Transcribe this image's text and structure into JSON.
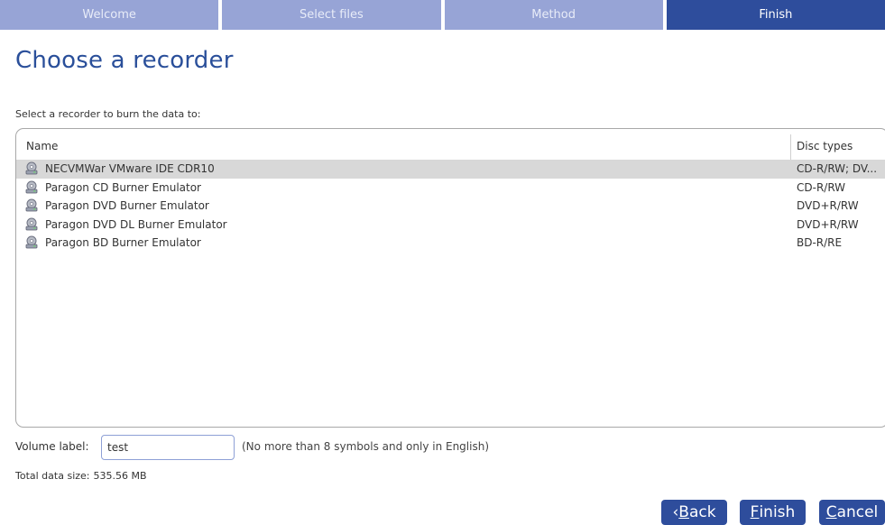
{
  "wizard": {
    "steps": [
      {
        "label": "Welcome"
      },
      {
        "label": "Select files"
      },
      {
        "label": "Method"
      },
      {
        "label": "Finish"
      }
    ],
    "active_step": "Finish"
  },
  "page": {
    "title": "Choose a recorder",
    "instruction": "Select a recorder to burn the data to:"
  },
  "recorders": {
    "columns": {
      "name": "Name",
      "disc_types": "Disc types"
    },
    "rows": [
      {
        "name": "NECVMWar VMware IDE CDR10",
        "disc": "CD-R/RW; DV...",
        "selected": true
      },
      {
        "name": "Paragon CD Burner Emulator",
        "disc": "CD-R/RW",
        "selected": false
      },
      {
        "name": "Paragon DVD Burner Emulator",
        "disc": "DVD+R/RW",
        "selected": false
      },
      {
        "name": "Paragon DVD DL Burner Emulator",
        "disc": "DVD+R/RW",
        "selected": false
      },
      {
        "name": "Paragon BD Burner Emulator",
        "disc": "BD-R/RE",
        "selected": false
      }
    ],
    "icon": "optical-drive-icon"
  },
  "volume": {
    "label": "Volume label:",
    "value": "test",
    "hint": "(No more than 8 symbols and only in English)"
  },
  "total": {
    "label": "Total data size:",
    "value": "535.56 MB"
  },
  "buttons": {
    "back": {
      "prefix": "‹ ",
      "accel": "B",
      "rest": "ack"
    },
    "finish": {
      "accel": "F",
      "rest": "inish"
    },
    "cancel": {
      "accel": "C",
      "rest": "ancel"
    }
  },
  "colors": {
    "step_inactive": "#97a4d6",
    "step_active": "#2e4d9c",
    "title": "#2a4f9a",
    "button": "#2e4d9c",
    "row_selected": "#d8d8d8"
  }
}
